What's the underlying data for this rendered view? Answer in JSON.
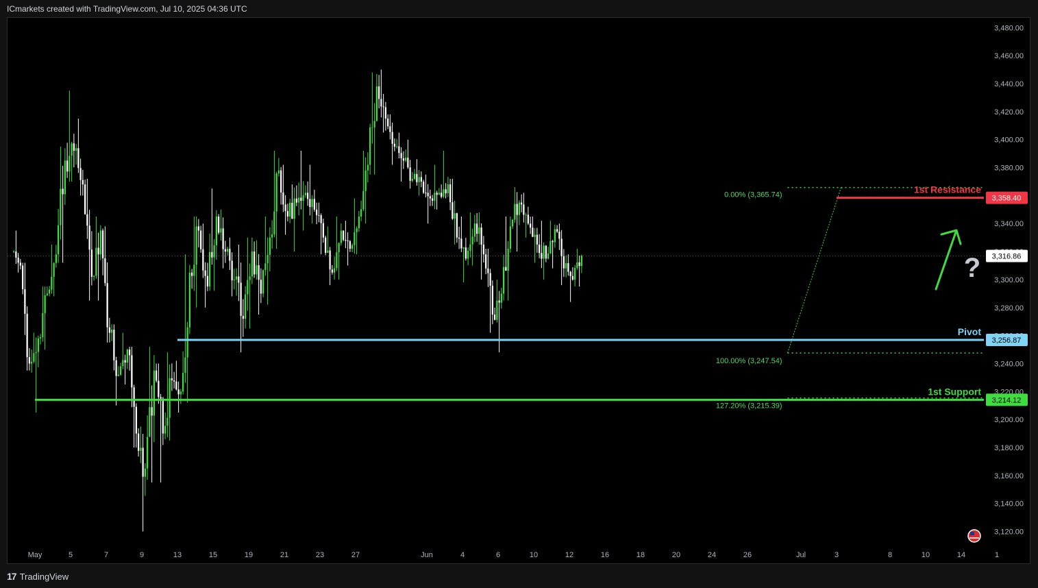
{
  "header": {
    "text": "ICmarkets created with TradingView.com, Jul 10, 2025 04:36 UTC"
  },
  "footer": {
    "logo": "17",
    "brand": "TradingView"
  },
  "chart_data": {
    "type": "candlestick",
    "ylim": [
      3110,
      3487
    ],
    "y_ticks": [
      3120,
      3140,
      3160,
      3180,
      3200,
      3220,
      3240,
      3260,
      3280,
      3300,
      3320,
      3340,
      3360,
      3380,
      3400,
      3420,
      3440,
      3460,
      3480
    ],
    "y_tick_labels": [
      "3,120.00",
      "3,140.00",
      "3,160.00",
      "3,180.00",
      "3,200.00",
      "3,220.00",
      "3,240.00",
      "3,260.00",
      "3,280.00",
      "3,300.00",
      "3,320.00",
      "3,340.00",
      "3,360.00",
      "3,380.00",
      "3,400.00",
      "3,420.00",
      "3,440.00",
      "3,460.00",
      "3,480.00"
    ],
    "x_ticks": [
      {
        "label": "May",
        "idx": 2
      },
      {
        "label": "5",
        "idx": 6
      },
      {
        "label": "7",
        "idx": 10
      },
      {
        "label": "9",
        "idx": 14
      },
      {
        "label": "13",
        "idx": 18
      },
      {
        "label": "15",
        "idx": 22
      },
      {
        "label": "19",
        "idx": 26
      },
      {
        "label": "21",
        "idx": 30
      },
      {
        "label": "23",
        "idx": 34
      },
      {
        "label": "27",
        "idx": 38
      },
      {
        "label": "Jun",
        "idx": 46
      },
      {
        "label": "4",
        "idx": 50
      },
      {
        "label": "6",
        "idx": 54
      },
      {
        "label": "10",
        "idx": 58
      },
      {
        "label": "12",
        "idx": 62
      },
      {
        "label": "16",
        "idx": 66
      },
      {
        "label": "18",
        "idx": 70
      },
      {
        "label": "20",
        "idx": 74
      },
      {
        "label": "24",
        "idx": 78
      },
      {
        "label": "26",
        "idx": 82
      },
      {
        "label": "Jul",
        "idx": 88
      },
      {
        "label": "3",
        "idx": 92
      },
      {
        "label": "8",
        "idx": 98
      },
      {
        "label": "10",
        "idx": 102
      },
      {
        "label": "14",
        "idx": 106
      },
      {
        "label": "1",
        "idx": 110
      }
    ],
    "levels": [
      {
        "name": "1st Resistance",
        "value": 3358.4,
        "label": "3,358.40",
        "color": "#f23645",
        "from_idx": 92
      },
      {
        "name": "Pivot",
        "value": 3256.87,
        "label": "3,256.87",
        "color": "#7fd3f4",
        "from_idx": 18
      },
      {
        "name": "1st Support",
        "value": 3214.12,
        "label": "3,214.12",
        "color": "#3fdc3f",
        "from_idx": 2
      }
    ],
    "last_price": {
      "value": 3316.86,
      "label": "3,316.86"
    },
    "fib": {
      "from_idx": 86.5,
      "to_idx": 92.5,
      "levels": [
        {
          "value": 3365.74,
          "label": "0.00% (3,365.74)"
        },
        {
          "value": 3247.54,
          "label": "100.00% (3,247.54)"
        },
        {
          "value": 3215.39,
          "label": "127.20% (3,215.39)"
        }
      ]
    },
    "annotations": {
      "question": "?"
    },
    "daily": [
      [
        3320,
        3335,
        3305,
        3310
      ],
      [
        3310,
        3312,
        3235,
        3240
      ],
      [
        3240,
        3262,
        3205,
        3258
      ],
      [
        3258,
        3295,
        3250,
        3290
      ],
      [
        3290,
        3325,
        3288,
        3318
      ],
      [
        3318,
        3395,
        3312,
        3385
      ],
      [
        3385,
        3435,
        3370,
        3392
      ],
      [
        3392,
        3415,
        3360,
        3368
      ],
      [
        3368,
        3372,
        3285,
        3302
      ],
      [
        3302,
        3345,
        3285,
        3335
      ],
      [
        3335,
        3338,
        3255,
        3262
      ],
      [
        3262,
        3268,
        3210,
        3232
      ],
      [
        3232,
        3262,
        3225,
        3250
      ],
      [
        3250,
        3252,
        3180,
        3190
      ],
      [
        3190,
        3195,
        3120,
        3165
      ],
      [
        3165,
        3252,
        3155,
        3235
      ],
      [
        3235,
        3240,
        3155,
        3190
      ],
      [
        3190,
        3248,
        3185,
        3228
      ],
      [
        3228,
        3242,
        3205,
        3220
      ],
      [
        3220,
        3318,
        3212,
        3305
      ],
      [
        3305,
        3345,
        3280,
        3335
      ],
      [
        3335,
        3340,
        3280,
        3295
      ],
      [
        3295,
        3365,
        3292,
        3345
      ],
      [
        3345,
        3350,
        3308,
        3320
      ],
      [
        3320,
        3330,
        3288,
        3300
      ],
      [
        3300,
        3325,
        3248,
        3272
      ],
      [
        3272,
        3330,
        3265,
        3320
      ],
      [
        3320,
        3328,
        3275,
        3290
      ],
      [
        3290,
        3345,
        3282,
        3330
      ],
      [
        3330,
        3392,
        3322,
        3378
      ],
      [
        3378,
        3382,
        3332,
        3345
      ],
      [
        3345,
        3368,
        3320,
        3355
      ],
      [
        3355,
        3392,
        3335,
        3362
      ],
      [
        3362,
        3382,
        3340,
        3350
      ],
      [
        3350,
        3355,
        3318,
        3330
      ],
      [
        3330,
        3338,
        3296,
        3305
      ],
      [
        3305,
        3345,
        3300,
        3335
      ],
      [
        3335,
        3342,
        3310,
        3322
      ],
      [
        3322,
        3358,
        3318,
        3345
      ],
      [
        3345,
        3392,
        3340,
        3382
      ],
      [
        3382,
        3448,
        3375,
        3438
      ],
      [
        3438,
        3450,
        3405,
        3415
      ],
      [
        3415,
        3418,
        3382,
        3395
      ],
      [
        3395,
        3405,
        3370,
        3385
      ],
      [
        3385,
        3400,
        3365,
        3372
      ],
      [
        3372,
        3386,
        3360,
        3370
      ],
      [
        3370,
        3375,
        3340,
        3358
      ],
      [
        3358,
        3382,
        3350,
        3362
      ],
      [
        3362,
        3392,
        3358,
        3368
      ],
      [
        3368,
        3372,
        3325,
        3330
      ],
      [
        3330,
        3345,
        3298,
        3315
      ],
      [
        3315,
        3348,
        3310,
        3340
      ],
      [
        3340,
        3348,
        3300,
        3318
      ],
      [
        3318,
        3322,
        3262,
        3275
      ],
      [
        3275,
        3300,
        3248,
        3290
      ],
      [
        3290,
        3345,
        3285,
        3338
      ],
      [
        3338,
        3366,
        3320,
        3355
      ],
      [
        3355,
        3362,
        3330,
        3340
      ],
      [
        3340,
        3345,
        3312,
        3325
      ],
      [
        3325,
        3342,
        3300,
        3315
      ],
      [
        3315,
        3342,
        3308,
        3336
      ],
      [
        3336,
        3340,
        3296,
        3308
      ],
      [
        3308,
        3318,
        3284,
        3300
      ],
      [
        3300,
        3322,
        3295,
        3317
      ]
    ]
  }
}
